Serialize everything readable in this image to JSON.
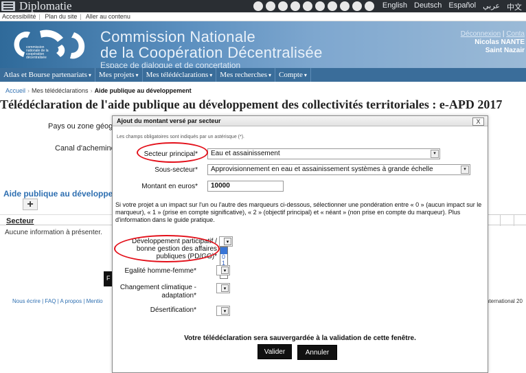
{
  "topbar": {
    "title": "Diplomatie",
    "languages": [
      "English",
      "Deutsch",
      "Español",
      "عربي",
      "中文"
    ]
  },
  "access": {
    "links": [
      "Accessibilité",
      "Plan du site",
      "Aller au contenu"
    ]
  },
  "banner": {
    "title_line1": "Commission Nationale",
    "title_line2": "de la Coopération Décentralisée",
    "subtitle": "Espace de dialogue et de concertation",
    "logo_text_lines": [
      "commission",
      "nationale de la",
      "coopération",
      "décentralisée"
    ],
    "user_links": [
      "Déconnexion",
      "Conta"
    ],
    "user_name": "Nicolas NANTE",
    "user_city": "Saint Nazair"
  },
  "menu": {
    "items": [
      {
        "label": "Atlas et Bourse partenariats",
        "caret": "▾"
      },
      {
        "label": "Mes projets",
        "caret": "▾"
      },
      {
        "label": "Mes télédéclarations",
        "caret": "▾"
      },
      {
        "label": "Mes recherches",
        "caret": "▾"
      },
      {
        "label": "Compte",
        "caret": "▾"
      }
    ]
  },
  "breadcrumb": {
    "home": "Accueil",
    "level1": "Mes télédéclarations",
    "current": "Aide publique au développement"
  },
  "page": {
    "title": "Télédéclaration de l'aide publique au développement des collectivités territoriales : e-APD 2017",
    "label_pays": "Pays ou zone géogra",
    "label_canal": "Canal d'acheminer",
    "section_aide": "Aide publique au développe",
    "plus": "+",
    "table_col_secteur": "Secteur",
    "no_info": "Aucune information à présenter.",
    "footer_links": "Nous écrire | FAQ | A propos | Mentio",
    "footer_right": "nternational 20",
    "dark_stub_text": "F"
  },
  "modal": {
    "title": "Ajout du montant versé par secteur",
    "close": "X",
    "required_note": "Les champs obligatoires sont indiqués par un astérisque (*).",
    "secteur_label": "Secteur principal*",
    "secteur_value": "Eau et assainissement",
    "sous_secteur_label": "Sous-secteur*",
    "sous_secteur_value": "Approvisionnement en eau et assainissement systèmes à grande échelle",
    "montant_label": "Montant en euros*",
    "montant_value": "10000",
    "paragraph": "Si votre projet a un impact sur l'un ou l'autre des marqueurs ci-dessous, sélectionner une pondération entre « 0 » (aucun impact sur le marqueur), « 1 » (prise en compte significative), « 2 » (objectif principal) et « néant » (non prise en compte du marqueur). Plus d'information dans le guide pratique.",
    "marker1_label_l1": "Développement participatif /",
    "marker1_label_l2": "bonne gestion des affaires",
    "marker1_label_l3": "publiques (PD/GG)*",
    "marker1_options": [
      "",
      "0",
      "1",
      "2"
    ],
    "marker2_label": "Egalité homme-femme*",
    "marker3_label_l1": "Changement climatique -",
    "marker3_label_l2": "adaptation*",
    "marker4_label": "Désertification*",
    "save_note": "Votre télédéclaration sera sauvergardée à la validation de cette fenêtre.",
    "validate": "Valider",
    "cancel": "Annuler",
    "select_arrow": "▾"
  },
  "colors": {
    "banner_blue": "#2f6a9a",
    "menu_blue": "#3a6d9a",
    "link_blue": "#2e6fb1",
    "annotation_red": "#e3101a"
  }
}
